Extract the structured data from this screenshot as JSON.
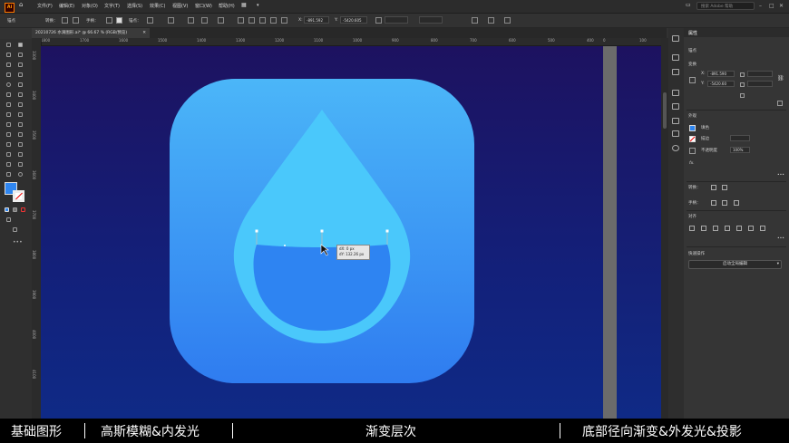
{
  "app": {
    "logo_text": "Ai"
  },
  "menubar": {
    "items": [
      "文件(F)",
      "编辑(E)",
      "对象(O)",
      "文字(T)",
      "选择(S)",
      "效果(C)",
      "视图(V)",
      "窗口(W)",
      "帮助(H)"
    ],
    "search_placeholder": "搜索 Adobe 帮助"
  },
  "controlbar": {
    "anchor_label": "锚点",
    "convert_label": "转换：",
    "handle_label": "手柄：",
    "anchor2_label": "锚点：",
    "x_label": "X:",
    "x_value": "-891.592",
    "y_label": "Y:",
    "y_value": "-5420.605"
  },
  "document": {
    "tab_title": "20210726 水滴图形.ai* @ 66.67 % (RGB/预览)"
  },
  "rulers": {
    "top": [
      "1800",
      "1700",
      "1600",
      "1500",
      "1400",
      "1300",
      "1200",
      "1100",
      "1000",
      "900",
      "800",
      "700",
      "600",
      "500",
      "400",
      "300",
      "200",
      "100",
      "0",
      "100"
    ],
    "left": [
      "3300",
      "3400",
      "3500",
      "3600",
      "3700",
      "3800",
      "3900",
      "4000",
      "4100"
    ]
  },
  "canvas": {
    "tooltip_line1": "dX: 0 px",
    "tooltip_line2": "dY: 132.26 px"
  },
  "properties": {
    "tab_title": "属性",
    "section_anchor": "锚点",
    "section_transform": "变换",
    "x_label": "X:",
    "x_value": "-891.590",
    "y_label": "Y:",
    "y_value": "-5420.60",
    "section_appearance": "外观",
    "fill_label": "填色",
    "stroke_label": "描边",
    "opacity_label": "不透明度",
    "opacity_value": "100%",
    "fx_label": "fx.",
    "convert_label": "转换：",
    "handle_label": "手柄：",
    "align_label": "对齐",
    "quick_actions_label": "快速操作",
    "global_edit_button": "启动全局编辑"
  },
  "captions": {
    "c1": "基础图形",
    "c2": "高斯模糊&内发光",
    "c3": "渐变层次",
    "c4": "底部径向渐变&外发光&投影"
  },
  "colors": {
    "icon_top": "#4bb6f8",
    "icon_bottom": "#2f7cf0",
    "drop": "#4ac8fb",
    "water": "#2e84f2",
    "canvas_top": "#1d1260",
    "canvas_bottom": "#0f2a86"
  }
}
